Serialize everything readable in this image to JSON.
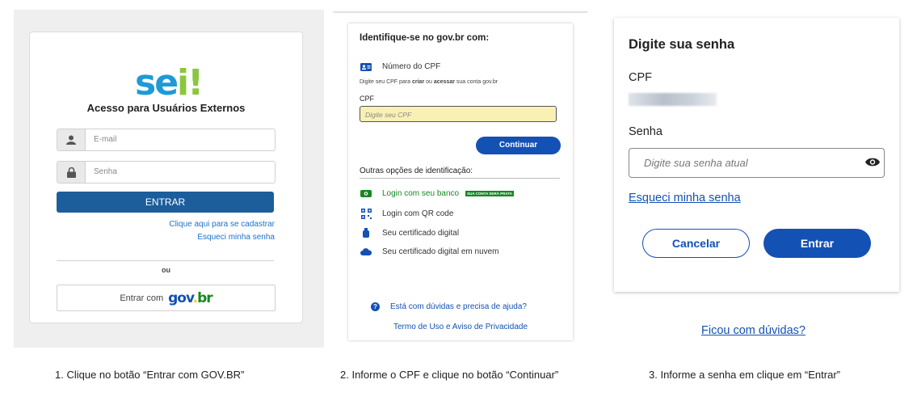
{
  "panel1": {
    "logo": {
      "s": "s",
      "e": "e",
      "i": "i",
      "bang": "!"
    },
    "title": "Acesso para Usuários Externos",
    "email_placeholder": "E-mail",
    "senha_placeholder": "Senha",
    "entrar_label": "ENTRAR",
    "cadastrar_link": "Clique aqui para se cadastrar",
    "esqueci_link": "Esqueci minha senha",
    "ou": "ou",
    "gov_prefix": "Entrar com",
    "gov_logo": {
      "g1": "gov",
      "g2": ".",
      "g3": "br"
    }
  },
  "panel2": {
    "heading": "Identifique-se no gov.br com:",
    "cpf_option": "Número do CPF",
    "small_a": "Digite seu CPF para ",
    "small_b": "criar",
    "small_c": " ou ",
    "small_d": "acessar",
    "small_e": " sua conta gov.br",
    "cpf_label": "CPF",
    "cpf_placeholder": "Digite seu CPF",
    "continuar": "Continuar",
    "outras": "Outras opções de identificação:",
    "options": [
      {
        "label": "Login com seu banco",
        "badge": "SUA CONTA SERÁ PRATA"
      },
      {
        "label": "Login com QR code"
      },
      {
        "label": "Seu certificado digital"
      },
      {
        "label": "Seu certificado digital em nuvem"
      }
    ],
    "help": "Está com dúvidas e precisa de ajuda?",
    "terms": "Termo de Uso e Aviso de Privacidade"
  },
  "panel3": {
    "heading": "Digite sua senha",
    "cpf_label": "CPF",
    "senha_label": "Senha",
    "senha_placeholder": "Digite sua senha atual",
    "esqueci": "Esqueci minha senha",
    "cancelar": "Cancelar",
    "entrar": "Entrar",
    "duvidas": "Ficou com dúvidas?"
  },
  "captions": [
    "1. Clique no botão “Entrar com GOV.BR”",
    "2. Informe o CPF e clique no botão “Continuar”",
    "3. Informe a senha em clique em “Entrar”"
  ],
  "colors": {
    "govbr_blue": "#1351b4",
    "sei_blue": "#1b5e9b",
    "badge_green": "#168821"
  }
}
